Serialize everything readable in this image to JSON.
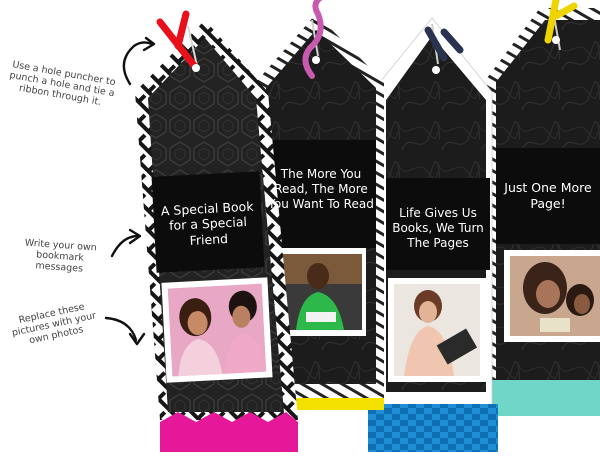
{
  "annotations": [
    {
      "id": "hole",
      "text": "Use a hole puncher to punch a hole and tie a ribbon through it."
    },
    {
      "id": "message",
      "text": "Write your own bookmark messages"
    },
    {
      "id": "photos",
      "text": "Replace these pictures with your own photos"
    }
  ],
  "bookmarks": [
    {
      "message": "A Special Book for a Special Friend",
      "ribbon_color": "#e8101a",
      "bottom_color": "#e6189a",
      "photo": "two-women-laughing-photo"
    },
    {
      "message": "The More You Read, The More You Want To Read",
      "ribbon_color": "#c85bb0",
      "bottom_color": "#f3e000",
      "photo": "reader-green-sweater-photo"
    },
    {
      "message": "Life Gives Us Books, We Turn The Pages",
      "ribbon_color": "#2a3450",
      "bottom_color": "#1e8fd6",
      "photo": "woman-with-book-photo"
    },
    {
      "message": "Just One More Page!",
      "ribbon_color": "#f0d400",
      "bottom_color": "#6fd6c8",
      "photo": "mother-daughter-reading-photo"
    }
  ]
}
